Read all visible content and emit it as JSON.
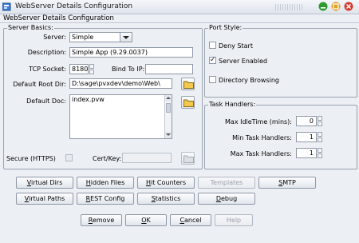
{
  "window": {
    "title": "WebServer Details Configuration",
    "subtitle": "WebServer Details Configuration",
    "colors": {
      "minimize": "#2f9a2f",
      "maximize": "#e0a020",
      "close": "#d23a2a"
    }
  },
  "server_basics": {
    "group_title": "Server Basics:",
    "server_label": "Server:",
    "server_value": "Simple",
    "description_label": "Description:",
    "description_value": "Simple App (9.29.0037)",
    "tcp_socket_label": "TCP Socket:",
    "tcp_socket_value": "8180",
    "bind_to_ip_label": "Bind To IP:",
    "bind_to_ip_value": "",
    "default_root_dir_label": "Default Root Dir:",
    "default_root_dir_value": "D:\\sage\\pvxdev\\demo\\Web\\",
    "default_doc_label": "Default Doc:",
    "default_doc_value": "index.pvw",
    "secure_label": "Secure (HTTPS)",
    "cert_key_label": "Cert/Key:",
    "cert_key_value": ""
  },
  "port_style": {
    "group_title": "Port Style:",
    "deny_start_label": "Deny Start",
    "deny_start_checked": false,
    "server_enabled_label": "Server Enabled",
    "server_enabled_checked": true,
    "directory_browsing_label": "Directory Browsing",
    "directory_browsing_checked": false
  },
  "task_handlers": {
    "group_title": "Task Handlers:",
    "max_idle_label": "Max IdleTime (mins):",
    "max_idle_value": "0",
    "min_task_label": "Min Task Handlers:",
    "min_task_value": "1",
    "max_task_label": "Max Task Handlers:",
    "max_task_value": "1"
  },
  "buttons": {
    "virtual_dirs": "Virtual Dirs",
    "hidden_files": "Hidden Files",
    "hit_counters": "Hit Counters",
    "templates": "Templates",
    "smtp": "SMTP",
    "virtual_paths": "Virtual Paths",
    "rest_config": "REST Config",
    "statistics": "Statistics",
    "debug": "Debug",
    "remove": "Remove",
    "ok": "OK",
    "cancel": "Cancel",
    "help": "Help"
  }
}
